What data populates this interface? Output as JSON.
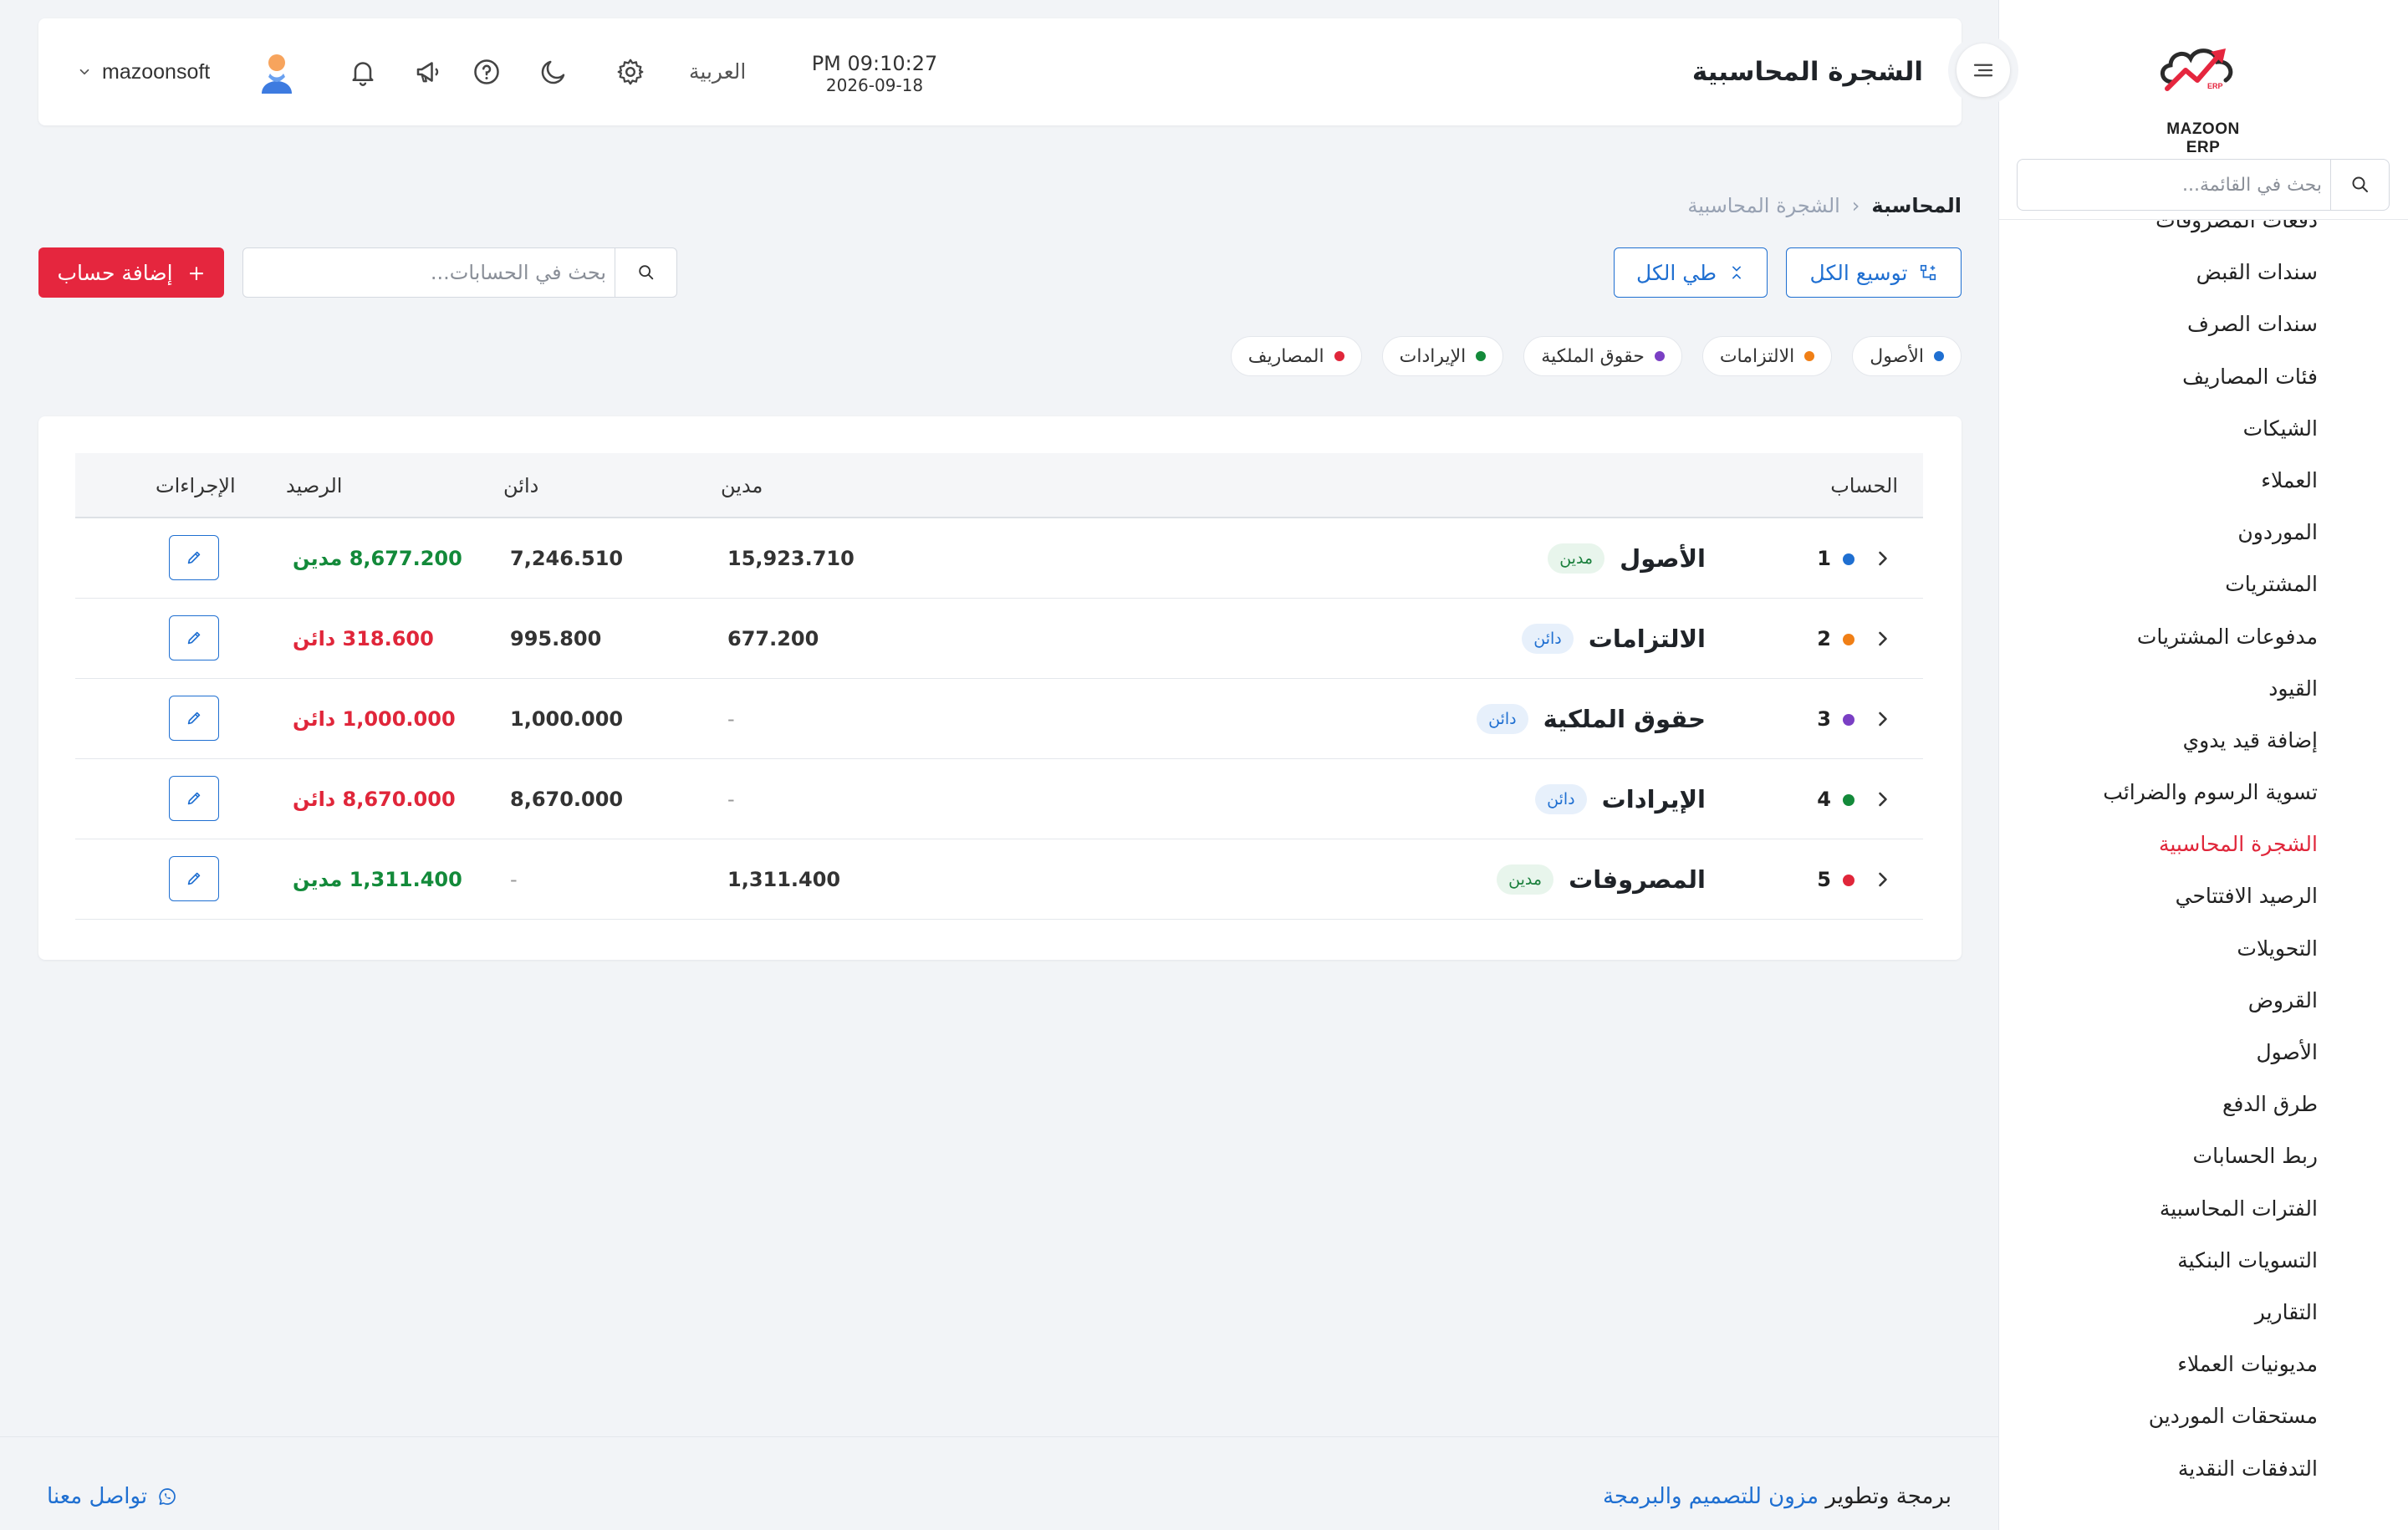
{
  "brand": {
    "logo_text": "MAZOON ERP",
    "accent": "#e5263e",
    "primary": "#1f6fd1"
  },
  "sidebar": {
    "search_placeholder": "بحث في القائمة...",
    "items": [
      {
        "label": "دفعات المصروفات"
      },
      {
        "label": "سندات القبض"
      },
      {
        "label": "سندات الصرف"
      },
      {
        "label": "فئات المصاريف"
      },
      {
        "label": "الشيكات"
      },
      {
        "label": "العملاء"
      },
      {
        "label": "الموردون"
      },
      {
        "label": "المشتريات"
      },
      {
        "label": "مدفوعات المشتريات"
      },
      {
        "label": "القيود"
      },
      {
        "label": "إضافة قيد يدوي"
      },
      {
        "label": "تسوية الرسوم والضرائب"
      },
      {
        "label": "الشجرة المحاسبية",
        "active": true
      },
      {
        "label": "الرصيد الافتتاحي"
      },
      {
        "label": "التحويلات"
      },
      {
        "label": "القروض"
      },
      {
        "label": "الأصول"
      },
      {
        "label": "طرق الدفع"
      },
      {
        "label": "ربط الحسابات"
      },
      {
        "label": "الفترات المحاسبية"
      },
      {
        "label": "التسويات البنكية"
      },
      {
        "label": "التقارير"
      },
      {
        "label": "مديونيات العملاء"
      },
      {
        "label": "مستحقات الموردين"
      },
      {
        "label": "التدفقات النقدية"
      }
    ]
  },
  "header": {
    "title": "الشجرة المحاسبية",
    "time": "PM 09:10:27",
    "date": "2026-09-18",
    "language": "العربية",
    "username": "mazoonsoft",
    "icons": [
      "menu-toggle-icon",
      "gear-icon",
      "moon-icon",
      "help-icon",
      "megaphone-icon",
      "bell-icon",
      "avatar",
      "chevron-down-icon"
    ]
  },
  "breadcrumb": {
    "root": "المحاسبة",
    "separator": "‹",
    "current": "الشجرة المحاسبية"
  },
  "toolbar": {
    "expand_all": "توسيع الكل",
    "collapse_all": "طي الكل",
    "search_placeholder": "بحث في الحسابات...",
    "add_account": "إضافة حساب",
    "add_symbol": "+"
  },
  "legend": [
    {
      "label": "الأصول",
      "color": "#1f6fd1"
    },
    {
      "label": "الالتزامات",
      "color": "#f07f16"
    },
    {
      "label": "حقوق الملكية",
      "color": "#7a3fc4"
    },
    {
      "label": "الإيرادات",
      "color": "#138a3a"
    },
    {
      "label": "المصاريف",
      "color": "#e0263a"
    }
  ],
  "table": {
    "headers": {
      "account": "الحساب",
      "debit": "مدين",
      "credit": "دائن",
      "balance": "الرصيد",
      "actions": "الإجراءات"
    },
    "rows": [
      {
        "num": "1",
        "name": "الأصول",
        "nature": "مدين",
        "nature_type": "debit",
        "debit": "15,923.710",
        "credit": "7,246.510",
        "balance": "8,677.200 مدين",
        "balance_type": "debit",
        "color": "#1f6fd1"
      },
      {
        "num": "2",
        "name": "الالتزامات",
        "nature": "دائن",
        "nature_type": "credit",
        "debit": "677.200",
        "credit": "995.800",
        "balance": "318.600 دائن",
        "balance_type": "credit",
        "color": "#f07f16"
      },
      {
        "num": "3",
        "name": "حقوق الملكية",
        "nature": "دائن",
        "nature_type": "credit",
        "debit": "-",
        "credit": "1,000.000",
        "balance": "1,000.000 دائن",
        "balance_type": "credit",
        "color": "#7a3fc4"
      },
      {
        "num": "4",
        "name": "الإيرادات",
        "nature": "دائن",
        "nature_type": "credit",
        "debit": "-",
        "credit": "8,670.000",
        "balance": "8,670.000 دائن",
        "balance_type": "credit",
        "color": "#138a3a"
      },
      {
        "num": "5",
        "name": "المصروفات",
        "nature": "مدين",
        "nature_type": "debit",
        "debit": "1,311.400",
        "credit": "-",
        "balance": "1,311.400 مدين",
        "balance_type": "debit",
        "color": "#e0263a"
      }
    ]
  },
  "footer": {
    "credit_prefix": "برمجة وتطوير",
    "credit_link": "مزون للتصميم والبرمجة",
    "contact": "تواصل معنا"
  }
}
